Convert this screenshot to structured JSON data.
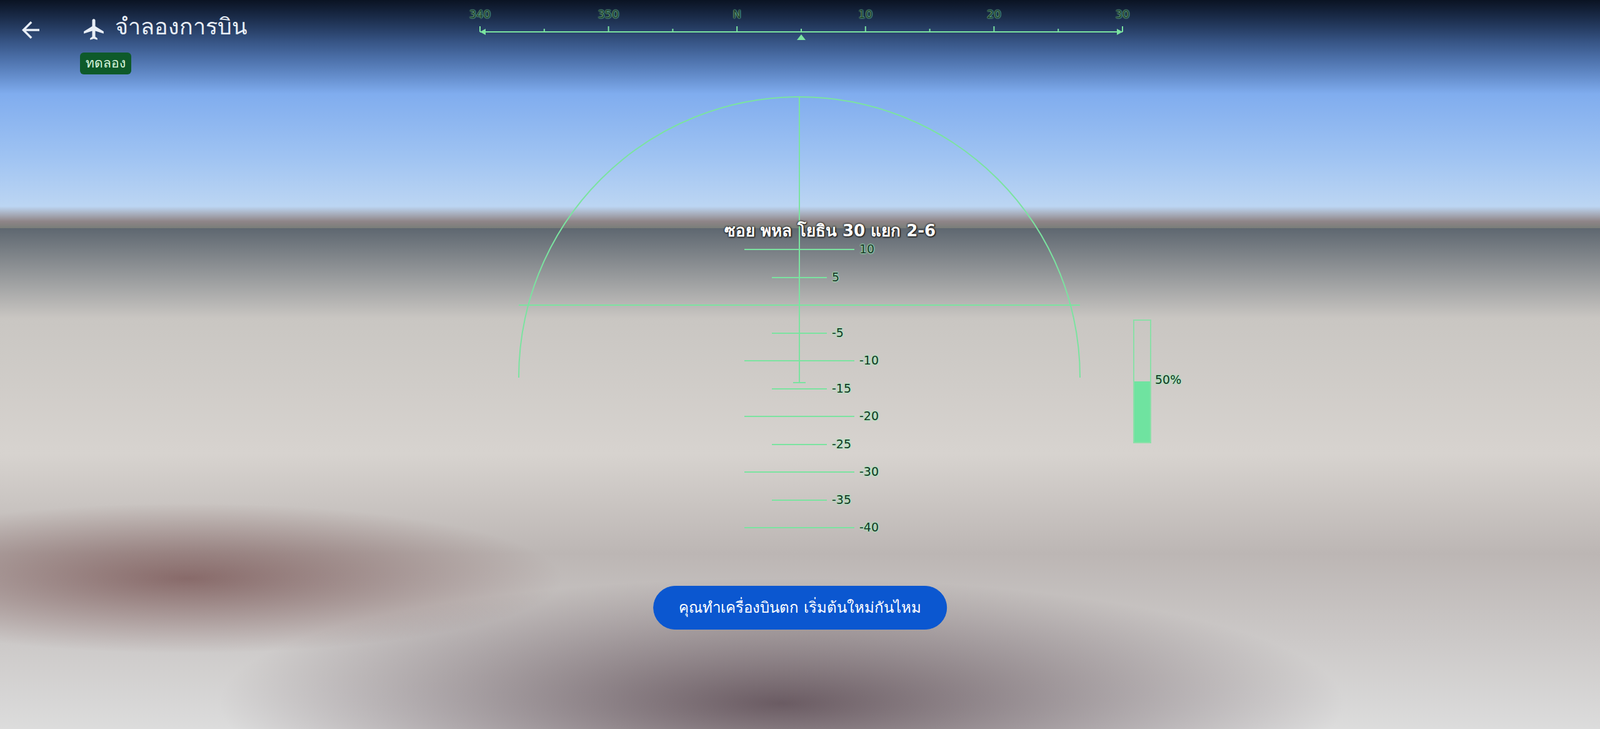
{
  "header": {
    "title": "จำลองการบิน",
    "badge": "ทดลอง"
  },
  "heading_tape": {
    "labels": [
      "340",
      "350",
      "N",
      "10",
      "20",
      "30"
    ]
  },
  "location_label": "ซอย พหล โยธิน 30 แยก 2-6",
  "pitch_ladder": [
    {
      "text": "10",
      "pitch": 10
    },
    {
      "text": "5",
      "pitch": 5
    },
    {
      "text": "-5",
      "pitch": -5
    },
    {
      "text": "-10",
      "pitch": -10
    },
    {
      "text": "-15",
      "pitch": -15
    },
    {
      "text": "-20",
      "pitch": -20
    },
    {
      "text": "-25",
      "pitch": -25
    },
    {
      "text": "-30",
      "pitch": -30
    },
    {
      "text": "-35",
      "pitch": -35
    },
    {
      "text": "-40",
      "pitch": -40
    }
  ],
  "throttle": {
    "level": 0.5,
    "reading": "50%"
  },
  "crash_prompt": {
    "button": "คุณทำเครื่องบินตก เริ่มต้นใหม่กันไหม"
  }
}
